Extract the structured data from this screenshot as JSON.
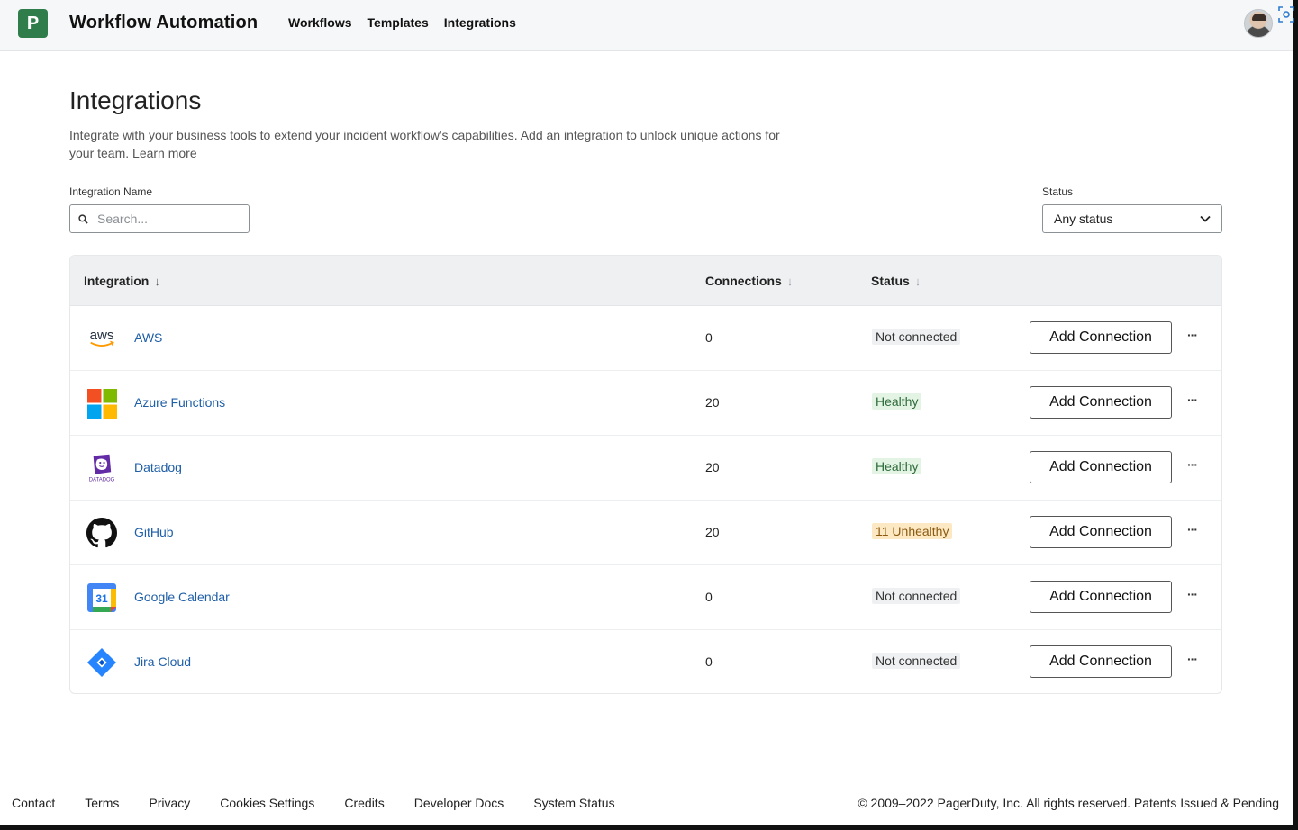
{
  "app": {
    "logo_letter": "P",
    "title": "Workflow Automation",
    "nav": [
      "Workflows",
      "Templates",
      "Integrations"
    ]
  },
  "page": {
    "title": "Integrations",
    "description": "Integrate with your business tools to extend your incident workflow's capabilities. Add an integration to unlock unique actions for your team.",
    "learn_more": "Learn more"
  },
  "filters": {
    "name_label": "Integration Name",
    "search_placeholder": "Search...",
    "status_label": "Status",
    "status_value": "Any status"
  },
  "table": {
    "headers": {
      "integration": "Integration",
      "connections": "Connections",
      "status": "Status"
    },
    "add_label": "Add Connection",
    "more_label": "···",
    "rows": [
      {
        "name": "AWS",
        "icon": "aws-icon",
        "connections": "0",
        "status": "Not connected",
        "status_kind": "neutral"
      },
      {
        "name": "Azure Functions",
        "icon": "azure-functions-icon",
        "connections": "20",
        "status": "Healthy",
        "status_kind": "healthy"
      },
      {
        "name": "Datadog",
        "icon": "datadog-icon",
        "connections": "20",
        "status": "Healthy",
        "status_kind": "healthy"
      },
      {
        "name": "GitHub",
        "icon": "github-icon",
        "connections": "20",
        "status": "11 Unhealthy",
        "status_kind": "warn"
      },
      {
        "name": "Google Calendar",
        "icon": "google-calendar-icon",
        "connections": "0",
        "status": "Not connected",
        "status_kind": "neutral"
      },
      {
        "name": "Jira Cloud",
        "icon": "jira-cloud-icon",
        "connections": "0",
        "status": "Not connected",
        "status_kind": "neutral"
      }
    ],
    "icon_text": {
      "aws": "aws",
      "datadog": "DATADOG",
      "calendar": "31"
    }
  },
  "footer": {
    "links": [
      "Contact",
      "Terms",
      "Privacy",
      "Cookies Settings",
      "Credits",
      "Developer Docs",
      "System Status"
    ],
    "copyright": "© 2009–2022 PagerDuty, Inc. All rights reserved. Patents Issued & Pending"
  },
  "colors": {
    "brand": "#2e7d4a",
    "link": "#1f5fa8",
    "healthy_bg": "#e3f3e4",
    "warn_bg": "#fde8c4"
  }
}
